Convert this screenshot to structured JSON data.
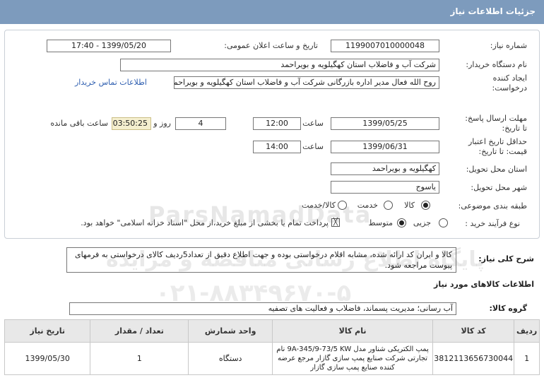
{
  "header": {
    "title": "جزئیات اطلاعات نیاز"
  },
  "form": {
    "need_number_label": "شماره نیاز:",
    "need_number": "1199007010000048",
    "announce_label": "تاریخ و ساعت اعلان عمومی:",
    "announce_value": "1399/05/20 - 17:40",
    "buyer_label": "نام دستگاه خریدار:",
    "buyer_value": "شرکت آب و فاضلاب استان کهگیلویه و بویراحمد",
    "creator_label_1": "ایجاد کننده",
    "creator_label_2": "درخواست:",
    "creator_value": "روح الله فعال مدیر اداره بازرگانی شرکت آب و فاضلاب استان کهگیلویه و بویراحمد",
    "contact_link": "اطلاعات تماس خریدار",
    "deadline_label_1": "مهلت ارسال پاسخ:",
    "deadline_label_2": "تا تاریخ:",
    "deadline_date": "1399/05/25",
    "time_label": "ساعت",
    "deadline_time": "12:00",
    "days_value": "4",
    "day_and_label": "روز و",
    "remaining_time": "03:50:25",
    "remaining_label": "ساعت باقی مانده",
    "validity_label_1": "حداقل تاریخ اعتبار",
    "validity_label_2": "قیمت: تا تاریخ:",
    "validity_date": "1399/06/31",
    "validity_time": "14:00",
    "province_label": "استان محل تحویل:",
    "province_value": "کهگیلویه و بویراحمد",
    "city_label": "شهر محل تحویل:",
    "city_value": "یاسوج",
    "category_label": "طبقه بندی موضوعی:",
    "cat_goods": "کالا",
    "cat_service": "خدمت",
    "cat_goods_service": "کالا/خدمت",
    "process_label": "نوع فرآیند خرید :",
    "proc_partial": "جزیی",
    "proc_medium": "متوسط",
    "payment_note": "پرداخت تمام یا بخشی از مبلغ خرید،از محل \"اسناد خزانه اسلامی\" خواهد بود."
  },
  "description": {
    "label": "شرح کلی نیاز:",
    "text": "کالا و ایران کد ارائه شده، مشابه اقلام درخواستی بوده و جهت اطلاع دقیق از تعداد5ردیف کالای درخواستی به فرمهای پیوست مراجعه شود."
  },
  "goods": {
    "section_title": "اطلاعات کالاهای مورد نیاز",
    "group_label": "گروه کالا:",
    "group_value": "آب رسانی؛ مدیریت پسماند، فاضلاب و فعالیت های تصفیه",
    "columns": [
      "ردیف",
      "کد کالا",
      "نام کالا",
      "واحد شمارش",
      "تعداد / مقدار",
      "تاریخ نیاز"
    ],
    "rows": [
      {
        "row": "1",
        "code": "3812113656730044",
        "name": "پمپ الکتریکی شناور مدل 9A-345/9-73/5 KW نام تجارتی شرکت صنایع پمپ سازی گازار مرجع عرضه کننده صنایع پمپ سازی گازار",
        "unit": "دستگاه",
        "qty": "1",
        "date": "1399/05/30"
      }
    ]
  },
  "watermark": {
    "brand": "ParsNamadData",
    "line2": "پایگاه اطلاع رسانی مناقصه و مزایده",
    "phone": "۰۲۱-۸۸۳۴۹۶۷۰-۵"
  }
}
